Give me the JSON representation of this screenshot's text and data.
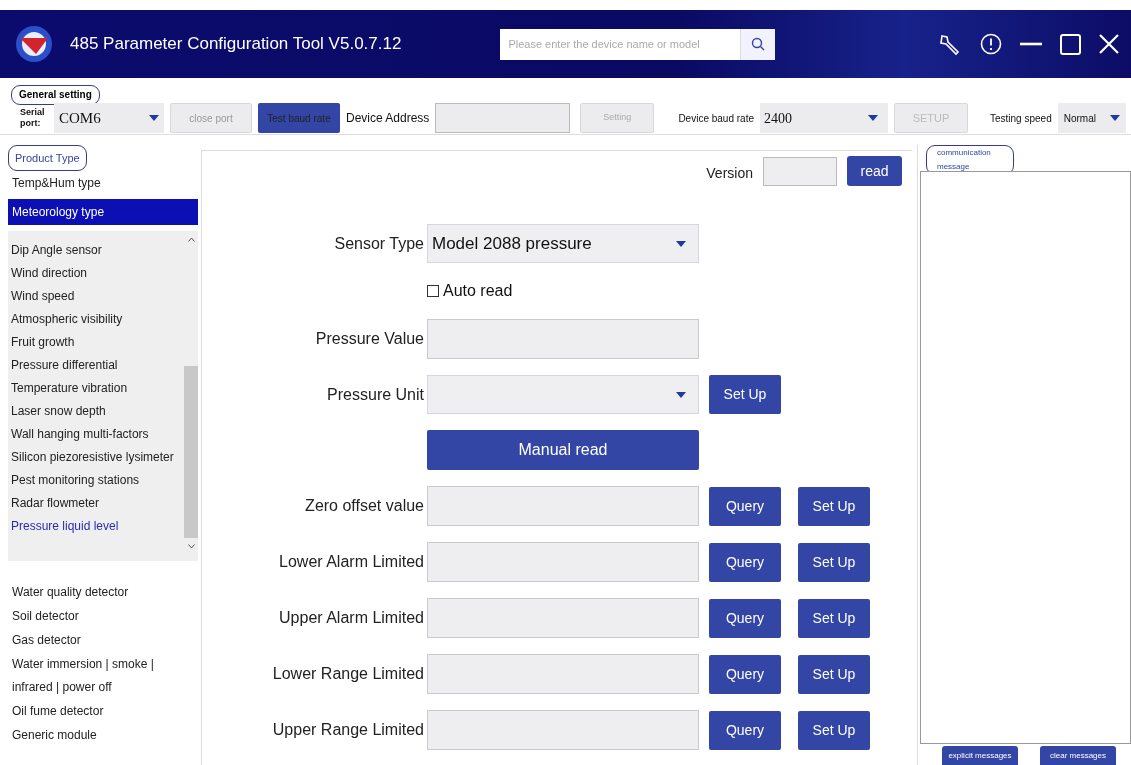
{
  "window": {
    "title": "485 Parameter Configuration Tool V5.0.7.12"
  },
  "search": {
    "placeholder": "Please enter the device name or model"
  },
  "general_setting": {
    "heading": "General setting",
    "serial_port_label": "Serial port:",
    "serial_port": "COM6",
    "close_port": "close port",
    "test_baud_rate": "Test baud rate",
    "device_address_label": "Device Address",
    "setting": "Setting",
    "device_baud_rate_label": "Device baud rate",
    "device_baud_rate": "2400",
    "setup": "SETUP",
    "testing_speed_label": "Testing speed",
    "testing_speed": "Normal"
  },
  "product_type": {
    "heading": "Product Type",
    "categories": [
      {
        "label": "Temp&Hum type",
        "selected": false
      },
      {
        "label": "Meteorology type",
        "selected": true,
        "children": [
          {
            "label": "Dip Angle sensor",
            "selected": false
          },
          {
            "label": "Wind direction",
            "selected": false
          },
          {
            "label": "Wind speed",
            "selected": false
          },
          {
            "label": "Atmospheric visibility",
            "selected": false
          },
          {
            "label": "Fruit growth",
            "selected": false
          },
          {
            "label": "Pressure differential",
            "selected": false
          },
          {
            "label": "Temperature vibration",
            "selected": false
          },
          {
            "label": "Laser snow depth",
            "selected": false
          },
          {
            "label": "Wall hanging multi-factors",
            "selected": false
          },
          {
            "label": "Silicon piezoresistive lysimeter",
            "selected": false
          },
          {
            "label": "Pest monitoring stations",
            "selected": false
          },
          {
            "label": "Radar flowmeter",
            "selected": false
          },
          {
            "label": "Pressure liquid level",
            "selected": true
          }
        ]
      },
      {
        "label": "Water quality detector",
        "selected": false
      },
      {
        "label": "Soil detector",
        "selected": false
      },
      {
        "label": "Gas detector",
        "selected": false
      },
      {
        "label": "Water immersion | smoke | infrared | power off",
        "selected": false
      },
      {
        "label": "Oil fume detector",
        "selected": false
      },
      {
        "label": "Generic module",
        "selected": false
      }
    ]
  },
  "version": {
    "label": "Version",
    "button": "read"
  },
  "form": [
    {
      "kind": "dropdown",
      "label": "Sensor Type",
      "value": "Model 2088 pressure"
    },
    {
      "kind": "checkbox",
      "label": "Auto read",
      "checked": false
    },
    {
      "kind": "field",
      "label": "Pressure Value"
    },
    {
      "kind": "dropdown",
      "label": "Pressure Unit",
      "buttons": [
        "Set Up"
      ]
    },
    {
      "kind": "button",
      "label": "Manual read"
    },
    {
      "kind": "field",
      "label": "Zero offset value",
      "buttons": [
        "Query",
        "Set Up"
      ]
    },
    {
      "kind": "field",
      "label": "Lower Alarm Limited",
      "buttons": [
        "Query",
        "Set Up"
      ]
    },
    {
      "kind": "field",
      "label": "Upper Alarm Limited",
      "buttons": [
        "Query",
        "Set Up"
      ]
    },
    {
      "kind": "field",
      "label": "Lower Range Limited",
      "buttons": [
        "Query",
        "Set Up"
      ]
    },
    {
      "kind": "field",
      "label": "Upper Range Limited",
      "buttons": [
        "Query",
        "Set Up"
      ]
    }
  ],
  "communication": {
    "heading": "communication message",
    "buttons": [
      "explicit messages",
      "clear messages"
    ]
  }
}
